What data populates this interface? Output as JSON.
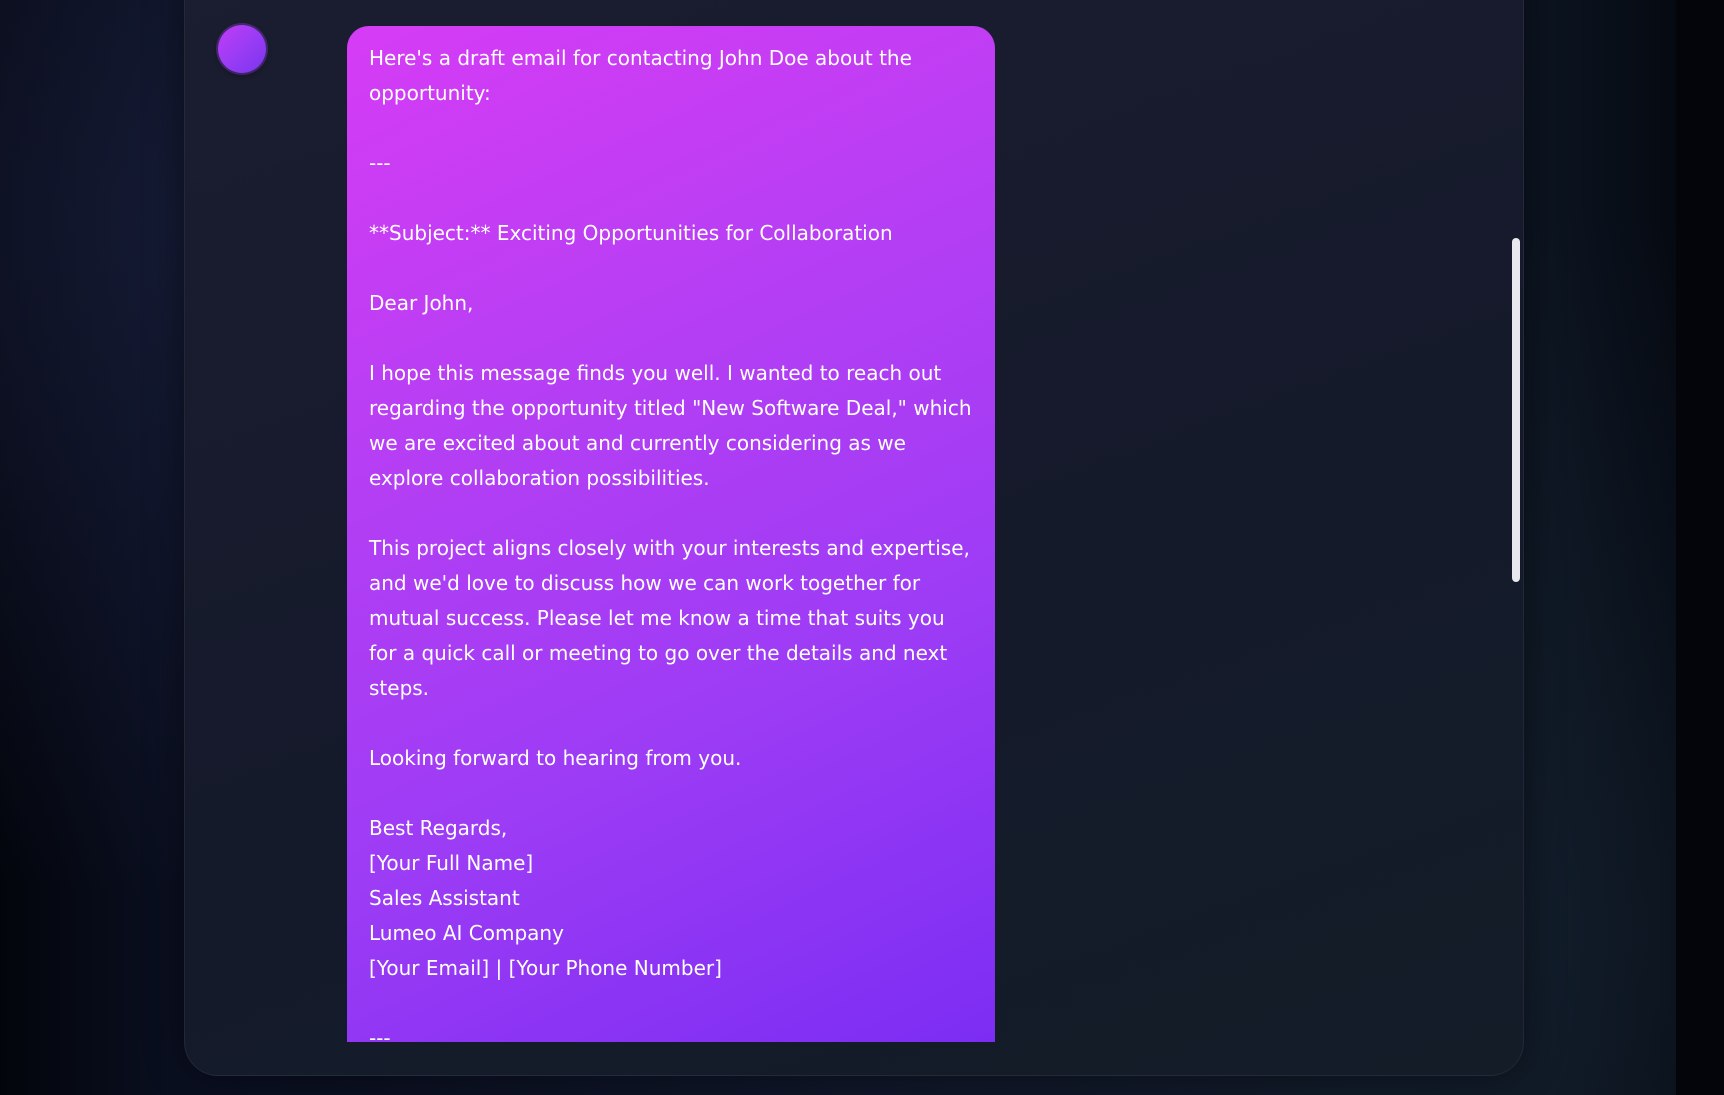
{
  "chat": {
    "assistant_message": {
      "text": "Here's a draft email for contacting John Doe about the opportunity:\n\n---\n\n**Subject:** Exciting Opportunities for Collaboration\n\nDear John,\n\nI hope this message finds you well. I wanted to reach out regarding the opportunity titled \"New Software Deal,\" which we are excited about and currently considering as we explore collaboration possibilities.\n\nThis project aligns closely with your interests and expertise, and we'd love to discuss how we can work together for mutual success. Please let me know a time that suits you for a quick call or meeting to go over the details and next steps.\n\nLooking forward to hearing from you.\n\nBest Regards,\n[Your Full Name]\nSales Assistant\nLumeo AI Company\n[Your Email] | [Your Phone Number]\n\n---"
    }
  },
  "colors": {
    "bubble_gradient_start": "#d63cf5",
    "bubble_gradient_end": "#7c2df3",
    "avatar": "#a03cf5",
    "panel_background": "#171b2c",
    "page_background": "#05070f",
    "scrollbar_thumb": "#e8e8ee"
  },
  "icons": {
    "avatar": "assistant-avatar-circle"
  }
}
